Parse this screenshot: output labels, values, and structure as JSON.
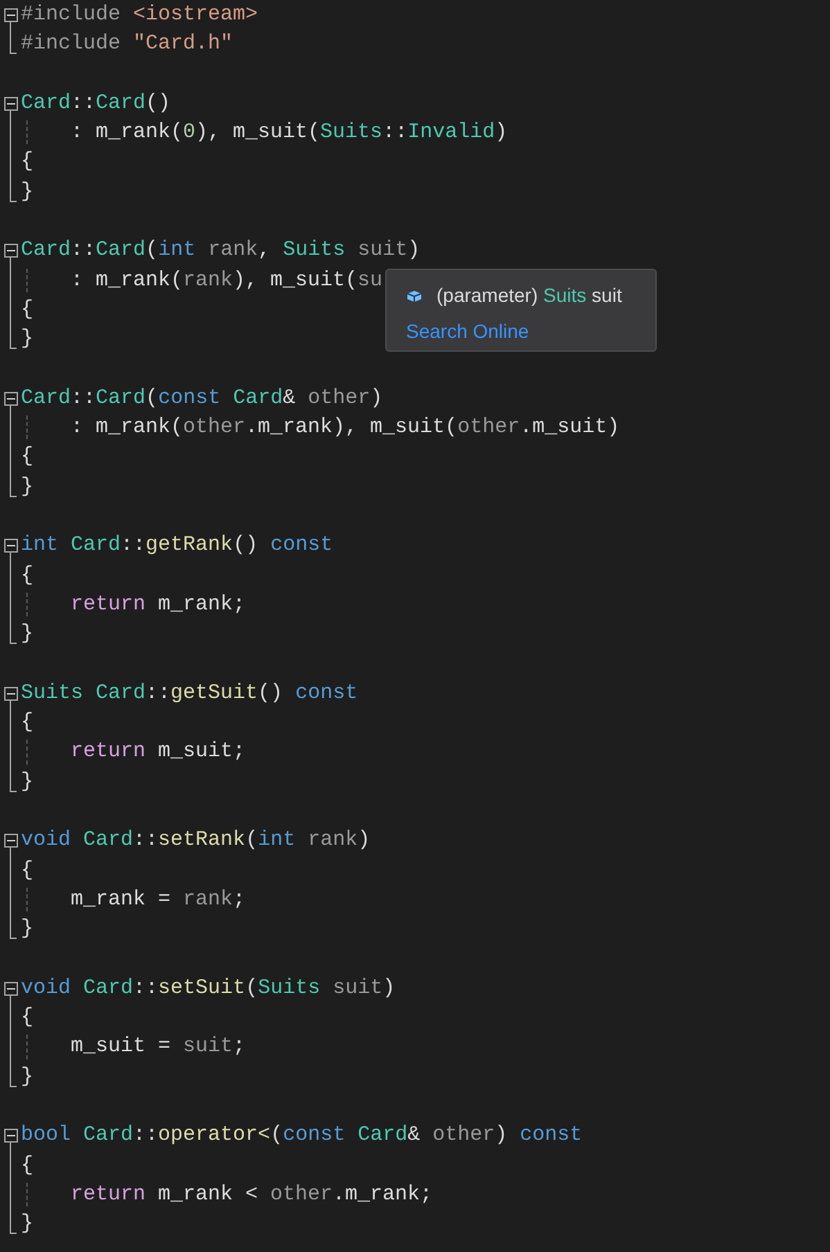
{
  "lines": [
    {
      "kind": "fold_start",
      "tokens": [
        {
          "kind": "pp",
          "t": "#include "
        },
        {
          "kind": "str",
          "t": "<iostream>"
        }
      ]
    },
    {
      "kind": "fold_end",
      "tokens": [
        {
          "kind": "pp",
          "t": "#include "
        },
        {
          "kind": "str",
          "t": "\"Card.h\""
        }
      ]
    },
    {
      "kind": "blank"
    },
    {
      "kind": "fold_start",
      "tokens": [
        {
          "kind": "type",
          "t": "Card"
        },
        {
          "kind": "plain",
          "t": "::"
        },
        {
          "kind": "type",
          "t": "Card"
        },
        {
          "kind": "plain",
          "t": "()"
        }
      ]
    },
    {
      "kind": "fold_body",
      "indented": true,
      "tokens": [
        {
          "kind": "plain",
          "t": ": m_rank("
        },
        {
          "kind": "num",
          "t": "0"
        },
        {
          "kind": "plain",
          "t": "), m_suit("
        },
        {
          "kind": "type",
          "t": "Suits"
        },
        {
          "kind": "plain",
          "t": "::"
        },
        {
          "kind": "type",
          "t": "Invalid"
        },
        {
          "kind": "plain",
          "t": ")"
        }
      ]
    },
    {
      "kind": "fold_body",
      "tokens": [
        {
          "kind": "plain",
          "t": "{"
        }
      ]
    },
    {
      "kind": "fold_end",
      "tokens": [
        {
          "kind": "plain",
          "t": "}"
        }
      ]
    },
    {
      "kind": "blank"
    },
    {
      "kind": "fold_start",
      "tokens": [
        {
          "kind": "type",
          "t": "Card"
        },
        {
          "kind": "plain",
          "t": "::"
        },
        {
          "kind": "type",
          "t": "Card"
        },
        {
          "kind": "plain",
          "t": "("
        },
        {
          "kind": "kw",
          "t": "int"
        },
        {
          "kind": "param",
          "t": " rank"
        },
        {
          "kind": "plain",
          "t": ", "
        },
        {
          "kind": "type",
          "t": "Suits"
        },
        {
          "kind": "param",
          "t": " suit"
        },
        {
          "kind": "plain",
          "t": ")"
        }
      ]
    },
    {
      "kind": "fold_body",
      "indented": true,
      "tokens": [
        {
          "kind": "plain",
          "t": ": m_rank("
        },
        {
          "kind": "param",
          "t": "rank"
        },
        {
          "kind": "plain",
          "t": "), m_suit("
        },
        {
          "kind": "param",
          "t": "su"
        }
      ]
    },
    {
      "kind": "fold_body",
      "tokens": [
        {
          "kind": "plain",
          "t": "{"
        }
      ]
    },
    {
      "kind": "fold_end",
      "tokens": [
        {
          "kind": "plain",
          "t": "}"
        }
      ]
    },
    {
      "kind": "blank"
    },
    {
      "kind": "fold_start",
      "tokens": [
        {
          "kind": "type",
          "t": "Card"
        },
        {
          "kind": "plain",
          "t": "::"
        },
        {
          "kind": "type",
          "t": "Card"
        },
        {
          "kind": "plain",
          "t": "("
        },
        {
          "kind": "kw",
          "t": "const"
        },
        {
          "kind": "type",
          "t": " Card"
        },
        {
          "kind": "plain",
          "t": "& "
        },
        {
          "kind": "param",
          "t": "other"
        },
        {
          "kind": "plain",
          "t": ")"
        }
      ]
    },
    {
      "kind": "fold_body",
      "indented": true,
      "tokens": [
        {
          "kind": "plain",
          "t": ": m_rank("
        },
        {
          "kind": "param",
          "t": "other"
        },
        {
          "kind": "plain",
          "t": ".m_rank), m_suit("
        },
        {
          "kind": "param",
          "t": "other"
        },
        {
          "kind": "plain",
          "t": ".m_suit)"
        }
      ]
    },
    {
      "kind": "fold_body",
      "tokens": [
        {
          "kind": "plain",
          "t": "{"
        }
      ]
    },
    {
      "kind": "fold_end",
      "tokens": [
        {
          "kind": "plain",
          "t": "}"
        }
      ]
    },
    {
      "kind": "blank"
    },
    {
      "kind": "fold_start",
      "tokens": [
        {
          "kind": "kw",
          "t": "int"
        },
        {
          "kind": "type",
          "t": " Card"
        },
        {
          "kind": "plain",
          "t": "::"
        },
        {
          "kind": "fn",
          "t": "getRank"
        },
        {
          "kind": "plain",
          "t": "() "
        },
        {
          "kind": "kw",
          "t": "const"
        }
      ]
    },
    {
      "kind": "fold_body",
      "tokens": [
        {
          "kind": "plain",
          "t": "{"
        }
      ]
    },
    {
      "kind": "fold_body",
      "indented": true,
      "tokens": [
        {
          "kind": "ctrl",
          "t": "return"
        },
        {
          "kind": "plain",
          "t": " m_rank;"
        }
      ]
    },
    {
      "kind": "fold_end",
      "tokens": [
        {
          "kind": "plain",
          "t": "}"
        }
      ]
    },
    {
      "kind": "blank"
    },
    {
      "kind": "fold_start",
      "tokens": [
        {
          "kind": "type",
          "t": "Suits Card"
        },
        {
          "kind": "plain",
          "t": "::"
        },
        {
          "kind": "fn",
          "t": "getSuit"
        },
        {
          "kind": "plain",
          "t": "() "
        },
        {
          "kind": "kw",
          "t": "const"
        }
      ]
    },
    {
      "kind": "fold_body",
      "tokens": [
        {
          "kind": "plain",
          "t": "{"
        }
      ]
    },
    {
      "kind": "fold_body",
      "indented": true,
      "tokens": [
        {
          "kind": "ctrl",
          "t": "return"
        },
        {
          "kind": "plain",
          "t": " m_suit;"
        }
      ]
    },
    {
      "kind": "fold_end",
      "tokens": [
        {
          "kind": "plain",
          "t": "}"
        }
      ]
    },
    {
      "kind": "blank"
    },
    {
      "kind": "fold_start",
      "tokens": [
        {
          "kind": "kw",
          "t": "void"
        },
        {
          "kind": "type",
          "t": " Card"
        },
        {
          "kind": "plain",
          "t": "::"
        },
        {
          "kind": "fn",
          "t": "setRank"
        },
        {
          "kind": "plain",
          "t": "("
        },
        {
          "kind": "kw",
          "t": "int"
        },
        {
          "kind": "param",
          "t": " rank"
        },
        {
          "kind": "plain",
          "t": ")"
        }
      ]
    },
    {
      "kind": "fold_body",
      "tokens": [
        {
          "kind": "plain",
          "t": "{"
        }
      ]
    },
    {
      "kind": "fold_body",
      "indented": true,
      "tokens": [
        {
          "kind": "plain",
          "t": "m_rank = "
        },
        {
          "kind": "param",
          "t": "rank"
        },
        {
          "kind": "plain",
          "t": ";"
        }
      ]
    },
    {
      "kind": "fold_end",
      "tokens": [
        {
          "kind": "plain",
          "t": "}"
        }
      ]
    },
    {
      "kind": "blank"
    },
    {
      "kind": "fold_start",
      "tokens": [
        {
          "kind": "kw",
          "t": "void"
        },
        {
          "kind": "type",
          "t": " Card"
        },
        {
          "kind": "plain",
          "t": "::"
        },
        {
          "kind": "fn",
          "t": "setSuit"
        },
        {
          "kind": "plain",
          "t": "("
        },
        {
          "kind": "type",
          "t": "Suits"
        },
        {
          "kind": "param",
          "t": " suit"
        },
        {
          "kind": "plain",
          "t": ")"
        }
      ]
    },
    {
      "kind": "fold_body",
      "tokens": [
        {
          "kind": "plain",
          "t": "{"
        }
      ]
    },
    {
      "kind": "fold_body",
      "indented": true,
      "tokens": [
        {
          "kind": "plain",
          "t": "m_suit = "
        },
        {
          "kind": "param",
          "t": "suit"
        },
        {
          "kind": "plain",
          "t": ";"
        }
      ]
    },
    {
      "kind": "fold_end",
      "tokens": [
        {
          "kind": "plain",
          "t": "}"
        }
      ]
    },
    {
      "kind": "blank"
    },
    {
      "kind": "fold_start",
      "tokens": [
        {
          "kind": "kw",
          "t": "bool"
        },
        {
          "kind": "type",
          "t": " Card"
        },
        {
          "kind": "plain",
          "t": "::"
        },
        {
          "kind": "fn",
          "t": "operator<"
        },
        {
          "kind": "plain",
          "t": "("
        },
        {
          "kind": "kw",
          "t": "const"
        },
        {
          "kind": "type",
          "t": " Card"
        },
        {
          "kind": "plain",
          "t": "& "
        },
        {
          "kind": "param",
          "t": "other"
        },
        {
          "kind": "plain",
          "t": ") "
        },
        {
          "kind": "kw",
          "t": "const"
        }
      ]
    },
    {
      "kind": "fold_body",
      "tokens": [
        {
          "kind": "plain",
          "t": "{"
        }
      ]
    },
    {
      "kind": "fold_body",
      "indented": true,
      "tokens": [
        {
          "kind": "ctrl",
          "t": "return"
        },
        {
          "kind": "plain",
          "t": " m_rank < "
        },
        {
          "kind": "param",
          "t": "other"
        },
        {
          "kind": "plain",
          "t": ".m_rank;"
        }
      ]
    },
    {
      "kind": "fold_end",
      "tokens": [
        {
          "kind": "plain",
          "t": "}"
        }
      ]
    }
  ],
  "tooltip": {
    "signature": [
      {
        "kind": "plain",
        "t": "(parameter) "
      },
      {
        "kind": "type",
        "t": "Suits"
      },
      {
        "kind": "plain",
        "t": " suit"
      }
    ],
    "link": "Search Online"
  }
}
